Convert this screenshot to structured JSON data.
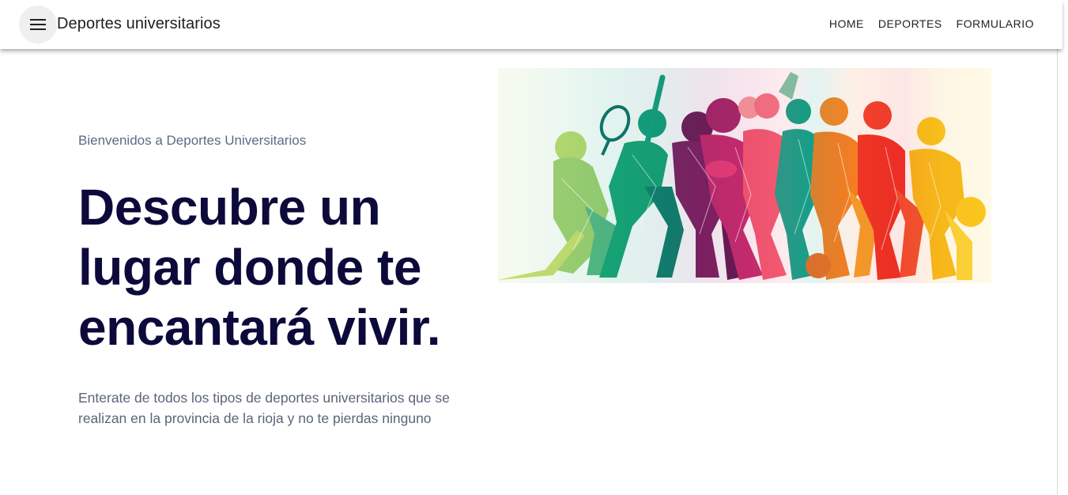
{
  "toolbar": {
    "title": "Deportes universitarios",
    "menu_icon": "menu-icon",
    "nav": [
      "HOME",
      "DEPORTES",
      "FORMULARIO"
    ]
  },
  "hero": {
    "eyebrow": "Bienvenidos a Deportes Universitarios",
    "headline_lines": [
      "Descubre un",
      "lugar donde te",
      "encantará vivir."
    ],
    "lead": "Enterate de todos los tipos de deportes universitarios que se realizan en la provincia de la rioja y no te pierdas ninguno",
    "image": "colorful-sports-silhouettes-illustration"
  },
  "colors": {
    "headline": "#0b0a3a",
    "eyebrow": "#5e6a84",
    "lead": "#5b6479",
    "toolbar_bg": "#ffffff"
  }
}
